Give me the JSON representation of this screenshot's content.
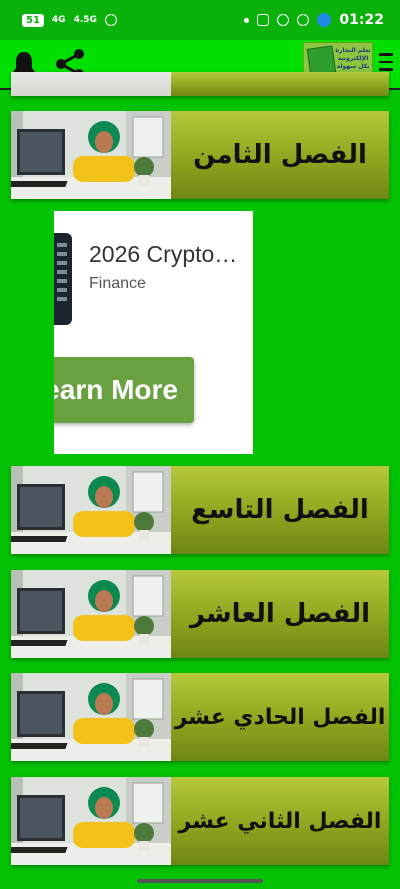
{
  "status_bar": {
    "sim": "51",
    "net1": "4G",
    "net2": "4.5G",
    "time": "01:22"
  },
  "app_bar": {
    "logo_text": "تعلم التجارة الإلكترونية بكل سهولة"
  },
  "chapters": [
    {
      "title": "الفصل الثامن"
    },
    {
      "title": "الفصل التاسع"
    },
    {
      "title": "الفصل العاشر"
    },
    {
      "title": "الفصل الحادي عشر"
    },
    {
      "title": "الفصل الثاني عشر"
    }
  ],
  "ad": {
    "title": "2026 Crypto…",
    "subtitle": "Finance",
    "cta": "earn More"
  },
  "colors": {
    "background": "#04c304",
    "status_bar": "#0bb10b",
    "app_bar": "#00e000",
    "banner_light": "#b7c83a",
    "banner_dark": "#6f8616",
    "ad_button": "#69a040"
  }
}
